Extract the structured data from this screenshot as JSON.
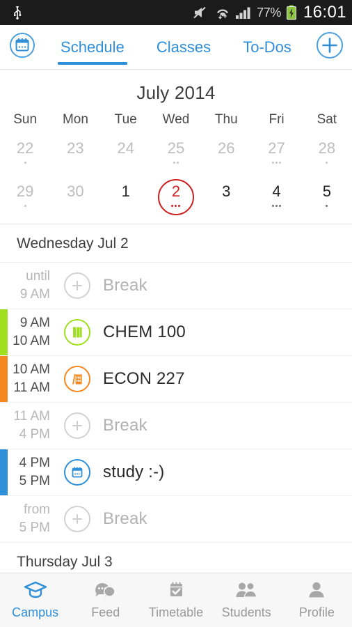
{
  "statusbar": {
    "usb_icon": "usb-icon",
    "mute_icon": "volume-mute-icon",
    "wifi_icon": "wifi-icon",
    "signal_icon": "cellular-signal-icon",
    "battery_percent": "77%",
    "battery_icon": "battery-charging-icon",
    "clock": "16:01"
  },
  "topbar": {
    "calendar_icon": "calendar-icon",
    "add_icon": "plus-icon",
    "tabs": [
      {
        "label": "Schedule",
        "active": true
      },
      {
        "label": "Classes",
        "active": false
      },
      {
        "label": "To-Dos",
        "active": false
      }
    ]
  },
  "calendar": {
    "month_title": "July 2014",
    "weekdays": [
      "Sun",
      "Mon",
      "Tue",
      "Wed",
      "Thu",
      "Fri",
      "Sat"
    ],
    "weeks": [
      [
        {
          "day": "22",
          "muted": true,
          "dots": 1,
          "today": false
        },
        {
          "day": "23",
          "muted": true,
          "dots": 0,
          "today": false
        },
        {
          "day": "24",
          "muted": true,
          "dots": 0,
          "today": false
        },
        {
          "day": "25",
          "muted": true,
          "dots": 2,
          "today": false
        },
        {
          "day": "26",
          "muted": true,
          "dots": 0,
          "today": false
        },
        {
          "day": "27",
          "muted": true,
          "dots": 3,
          "today": false
        },
        {
          "day": "28",
          "muted": true,
          "dots": 1,
          "today": false
        }
      ],
      [
        {
          "day": "29",
          "muted": true,
          "dots": 1,
          "today": false
        },
        {
          "day": "30",
          "muted": true,
          "dots": 0,
          "today": false
        },
        {
          "day": "1",
          "muted": false,
          "dots": 0,
          "today": false
        },
        {
          "day": "2",
          "muted": false,
          "dots": 3,
          "today": true
        },
        {
          "day": "3",
          "muted": false,
          "dots": 0,
          "today": false
        },
        {
          "day": "4",
          "muted": false,
          "dots": 3,
          "today": false
        },
        {
          "day": "5",
          "muted": false,
          "dots": 1,
          "today": false
        }
      ]
    ],
    "today_ring_color": "#cc1f1f"
  },
  "schedule": {
    "days": [
      {
        "header": "Wednesday Jul 2",
        "events": [
          {
            "time_from": "until",
            "time_to": "9 AM",
            "title": "Break",
            "type": "break",
            "icon": "plus-icon",
            "bar_color": "",
            "icon_color": "#cfcfcf"
          },
          {
            "time_from": "9 AM",
            "time_to": "10 AM",
            "title": "CHEM 100",
            "type": "class",
            "icon": "book-icon",
            "bar_color": "#9ee01e",
            "icon_color": "#9ee01e"
          },
          {
            "time_from": "10 AM",
            "time_to": "11 AM",
            "title": "ECON 227",
            "type": "class",
            "icon": "bank-building-icon",
            "bar_color": "#f5891f",
            "icon_color": "#f5891f"
          },
          {
            "time_from": "11 AM",
            "time_to": "4 PM",
            "title": "Break",
            "type": "break",
            "icon": "plus-icon",
            "bar_color": "",
            "icon_color": "#cfcfcf"
          },
          {
            "time_from": "4 PM",
            "time_to": "5 PM",
            "title": "study :-)",
            "type": "event",
            "icon": "calendar-icon",
            "bar_color": "#2f8fd8",
            "icon_color": "#2f8fd8"
          },
          {
            "time_from": "from",
            "time_to": "5 PM",
            "title": "Break",
            "type": "break",
            "icon": "plus-icon",
            "bar_color": "",
            "icon_color": "#cfcfcf"
          }
        ]
      },
      {
        "header": "Thursday Jul 3",
        "events": []
      }
    ]
  },
  "bottomnav": {
    "items": [
      {
        "label": "Campus",
        "icon": "graduation-cap-icon",
        "active": true
      },
      {
        "label": "Feed",
        "icon": "chat-bubbles-icon",
        "active": false
      },
      {
        "label": "Timetable",
        "icon": "calendar-check-icon",
        "active": false
      },
      {
        "label": "Students",
        "icon": "people-icon",
        "active": false
      },
      {
        "label": "Profile",
        "icon": "person-icon",
        "active": false
      }
    ]
  },
  "colors": {
    "accent": "#2f8fd8",
    "today": "#cc1f1f",
    "green": "#9ee01e",
    "orange": "#f5891f"
  }
}
